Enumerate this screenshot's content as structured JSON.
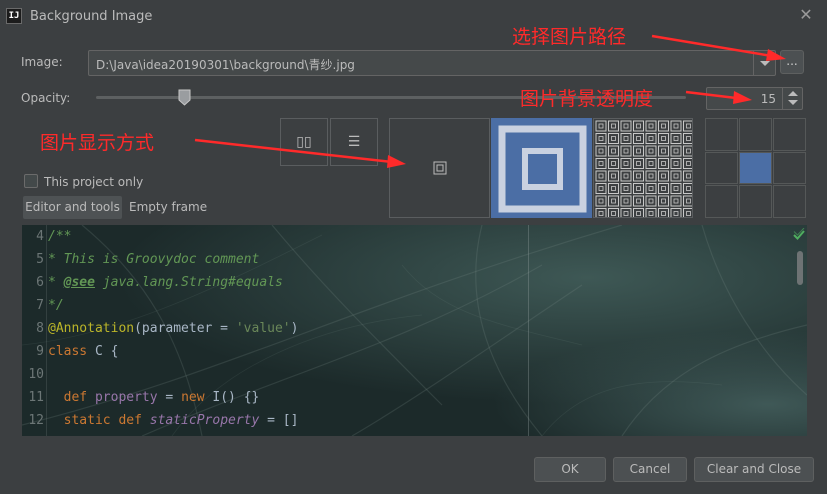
{
  "window": {
    "title": "Background Image",
    "app_icon_text": "IJ",
    "close_glyph": "✕"
  },
  "image_row": {
    "label": "Image:",
    "path_value": "D:\\Java\\idea20190301\\background\\青纱.jpg",
    "browse_label": "..."
  },
  "opacity_row": {
    "label": "Opacity:",
    "slider_percent": 15,
    "spinner_value": "15"
  },
  "flip": {
    "horizontal_glyph": "▯▯",
    "vertical_glyph": "☰"
  },
  "fill_modes": [
    {
      "name": "center",
      "selected": false
    },
    {
      "name": "scale",
      "selected": true
    },
    {
      "name": "tile",
      "selected": false
    }
  ],
  "anchor": {
    "selected_index": 4
  },
  "options": {
    "this_project_only_label": "This project only",
    "this_project_only_checked": false,
    "target_editor_and_tools": "Editor and tools",
    "target_empty_frame": "Empty frame"
  },
  "preview_code": [
    {
      "ln": "4",
      "segs": [
        [
          "c-doc",
          "/**"
        ]
      ]
    },
    {
      "ln": "5",
      "segs": [
        [
          "c-doc",
          "* This is Groovydoc comment"
        ]
      ]
    },
    {
      "ln": "6",
      "segs": [
        [
          "c-doc",
          "* "
        ],
        [
          "c-tag",
          "@see"
        ],
        [
          "c-doc",
          " java.lang.String#equals"
        ]
      ]
    },
    {
      "ln": "7",
      "segs": [
        [
          "c-doc",
          "*/"
        ]
      ]
    },
    {
      "ln": "8",
      "segs": [
        [
          "c-ann",
          "@Annotation"
        ],
        [
          "c-plain",
          "(parameter = "
        ],
        [
          "c-str",
          "'value'"
        ],
        [
          "c-plain",
          ")"
        ]
      ]
    },
    {
      "ln": "9",
      "segs": [
        [
          "c-kw",
          "class "
        ],
        [
          "c-plain",
          "C {"
        ]
      ]
    },
    {
      "ln": "10",
      "segs": []
    },
    {
      "ln": "11",
      "segs": [
        [
          "c-plain",
          "  "
        ],
        [
          "c-kw",
          "def "
        ],
        [
          "c-field",
          "property"
        ],
        [
          "c-plain",
          " = "
        ],
        [
          "c-kw",
          "new "
        ],
        [
          "c-plain",
          "I() {}"
        ]
      ]
    },
    {
      "ln": "12",
      "segs": [
        [
          "c-plain",
          "  "
        ],
        [
          "c-kw",
          "static def "
        ],
        [
          "c-static",
          "staticProperty"
        ],
        [
          "c-plain",
          " = []"
        ]
      ]
    }
  ],
  "buttons": {
    "ok": "OK",
    "cancel": "Cancel",
    "clear_and_close": "Clear and Close"
  },
  "annotations": {
    "path_note": "选择图片路径",
    "opacity_note": "图片背景透明度",
    "display_note": "图片显示方式"
  },
  "colors": {
    "accent_selected": "#4b6ea5",
    "annotation_red": "#ff2a2a",
    "dialog_bg": "#3c3f41"
  }
}
